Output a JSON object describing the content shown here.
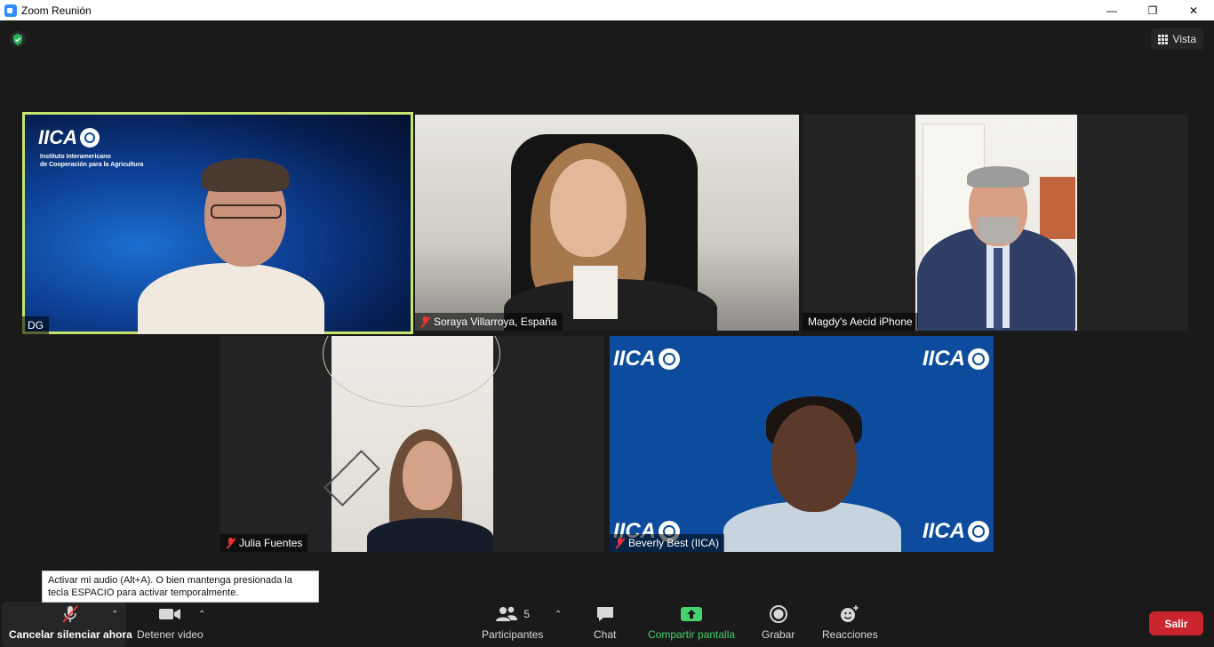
{
  "window": {
    "title": "Zoom Reunión",
    "controls": [
      "minimize-icon",
      "restore-icon",
      "close-icon"
    ]
  },
  "header": {
    "view_label": "Vista"
  },
  "participants_tiles": [
    {
      "name": "DG",
      "muted": false,
      "active_speaker": true
    },
    {
      "name": "Soraya Villarroya, España",
      "muted": true
    },
    {
      "name": "Magdy's Aecid iPhone",
      "muted": false
    },
    {
      "name": "Julia Fuentes",
      "muted": true
    },
    {
      "name": "Beverly Best (IICA)",
      "muted": true
    }
  ],
  "iica": {
    "logo_text": "IICA",
    "subtitle_line1": "Instituto Interamericano",
    "subtitle_line2": "de Cooperación para la Agricultura"
  },
  "tooltip": {
    "text": "Activar mi audio (Alt+A). O bien mantenga presionada la tecla ESPACIO para activar temporalmente."
  },
  "toolbar": {
    "mic_label": "Cancelar silenciar ahora",
    "video_label": "Detener video",
    "participants_label": "Participantes",
    "participants_count": "5",
    "chat_label": "Chat",
    "share_label": "Compartir pantalla",
    "record_label": "Grabar",
    "reactions_label": "Reacciones",
    "leave_label": "Salir"
  },
  "colors": {
    "active_speaker_border": "#c8e46f",
    "share_green": "#46d36b",
    "leave_red": "#c9252c",
    "muted_red": "#e33333"
  }
}
